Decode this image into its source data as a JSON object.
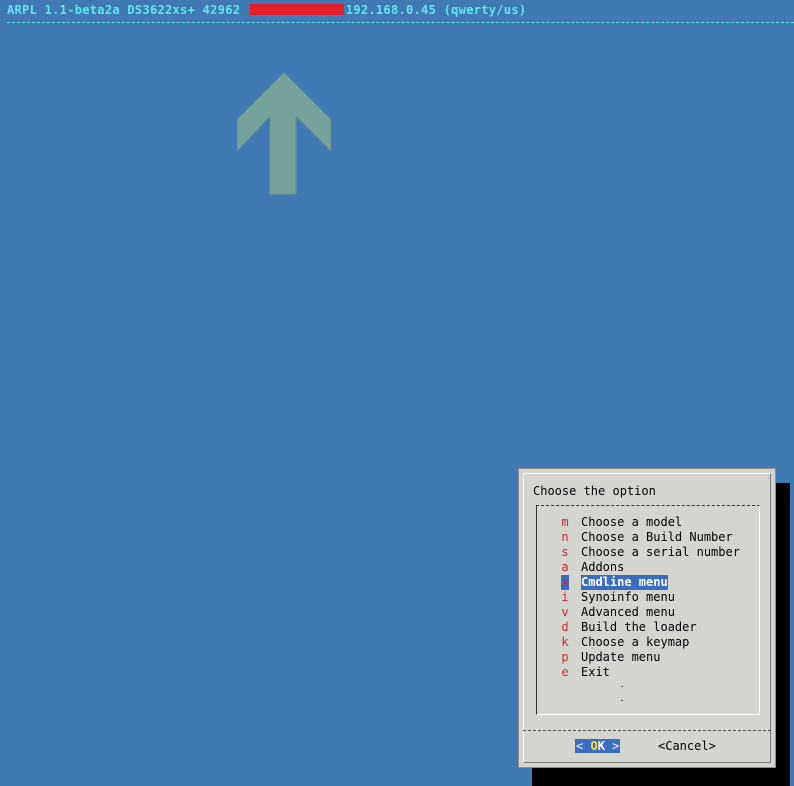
{
  "header": {
    "title_left": "ARPL 1.1-beta2a DS3622xs+ 42962",
    "title_right": "192.168.0.45 (qwerty/us)"
  },
  "colors": {
    "background": "#4079b4",
    "title_text": "#5fe7f7",
    "dialog_bg": "#d3d5ce",
    "hotkey": "#d12a2a",
    "selection": "#3a6cc0",
    "arrow": "#75a39b"
  },
  "dialog": {
    "prompt": "Choose the option",
    "items": [
      {
        "key": "m",
        "label": "Choose a model"
      },
      {
        "key": "n",
        "label": "Choose a Build Number"
      },
      {
        "key": "s",
        "label": "Choose a serial number"
      },
      {
        "key": "a",
        "label": "Addons"
      },
      {
        "key": "x",
        "label": "Cmdline menu"
      },
      {
        "key": "i",
        "label": "Synoinfo menu"
      },
      {
        "key": "v",
        "label": "Advanced menu"
      },
      {
        "key": "d",
        "label": "Build the loader"
      },
      {
        "key": "k",
        "label": "Choose a keymap"
      },
      {
        "key": "p",
        "label": "Update menu"
      },
      {
        "key": "e",
        "label": "Exit"
      }
    ],
    "selected_index": 4,
    "ok_button": {
      "left_bracket": "< ",
      "hotkey": "O",
      "rest": "K",
      "right_bracket": " >"
    },
    "cancel_button": "<Cancel>"
  }
}
